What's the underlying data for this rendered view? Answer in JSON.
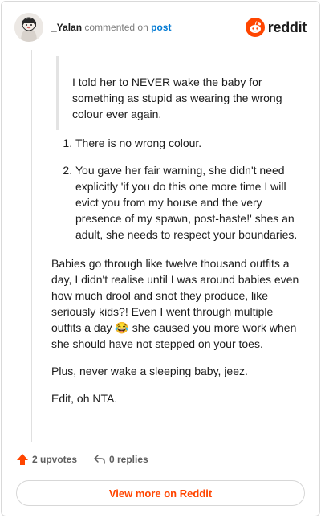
{
  "header": {
    "username": "_Yalan",
    "action": "commented on",
    "post_link": "post",
    "brand": "reddit"
  },
  "comment": {
    "quote": "I told her to NEVER wake the baby for something as stupid as wearing the wrong colour ever again.",
    "list": [
      "There is no wrong colour.",
      "You gave her fair warning, she didn't need explicitly 'if you do this one more time I will evict you from my house and the very presence of my spawn, post-haste!' shes an adult, she needs to respect your boundaries."
    ],
    "paragraph_1_before_emoji": "Babies go through like twelve thousand outfits a day, I didn't realise until I was around babies even how much drool and snot they produce, like seriously kids?! Even I went through multiple outfits a day",
    "emoji": "😂",
    "paragraph_1_after_emoji": " she caused you more work when she should have not stepped on your toes.",
    "paragraph_2": "Plus, never wake a sleeping baby, jeez.",
    "paragraph_3": "Edit, oh NTA."
  },
  "footer": {
    "upvotes_label": "2 upvotes",
    "replies_label": "0 replies",
    "view_more_label": "View more on Reddit"
  },
  "colors": {
    "brand": "#ff4500",
    "link": "#0079d3"
  }
}
